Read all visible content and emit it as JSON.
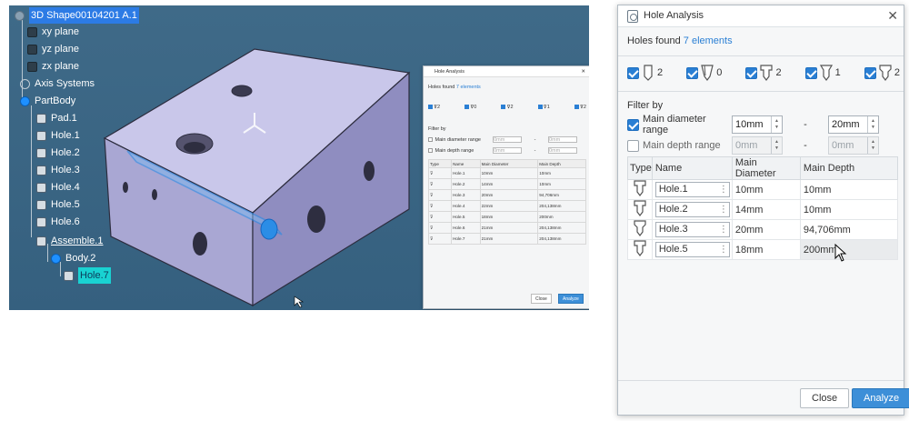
{
  "tree": {
    "root": "3D Shape00104201 A.1",
    "items": [
      {
        "label": "xy plane",
        "icon": "plane-icon"
      },
      {
        "label": "yz plane",
        "icon": "plane-icon"
      },
      {
        "label": "zx plane",
        "icon": "plane-icon"
      },
      {
        "label": "Axis Systems",
        "icon": "axis-system-icon"
      },
      {
        "label": "PartBody",
        "icon": "part-body-icon"
      },
      {
        "label": "Pad.1",
        "icon": "pad-icon"
      },
      {
        "label": "Hole.1",
        "icon": "hole-icon"
      },
      {
        "label": "Hole.2",
        "icon": "hole-icon"
      },
      {
        "label": "Hole.3",
        "icon": "hole-icon"
      },
      {
        "label": "Hole.4",
        "icon": "hole-icon"
      },
      {
        "label": "Hole.5",
        "icon": "hole-icon"
      },
      {
        "label": "Hole.6",
        "icon": "hole-icon"
      },
      {
        "label": "Assemble.1",
        "icon": "assemble-icon"
      },
      {
        "label": "Body.2",
        "icon": "body-icon"
      },
      {
        "label": "Hole.7",
        "icon": "hole-icon"
      }
    ]
  },
  "mini_dialog": {
    "title": "Hole Analysis",
    "found_label": "Holes found",
    "found_count": "7 elements",
    "type_counts": [
      "2",
      "0",
      "2",
      "1",
      "2"
    ],
    "filter_by": "Filter by",
    "diameter_label": "Main diameter range",
    "depth_label": "Main depth range",
    "min_placeholder": "0mm",
    "dash": "-",
    "headers": [
      "Type",
      "Name",
      "Main Diameter",
      "Main Depth"
    ],
    "rows": [
      {
        "name": "Hole.1",
        "diameter": "10mm",
        "depth": "10mm"
      },
      {
        "name": "Hole.2",
        "diameter": "14mm",
        "depth": "10mm"
      },
      {
        "name": "Hole.3",
        "diameter": "20mm",
        "depth": "94,706mm"
      },
      {
        "name": "Hole.4",
        "diameter": "22mm",
        "depth": "204,138mm"
      },
      {
        "name": "Hole.5",
        "diameter": "18mm",
        "depth": "200mm"
      },
      {
        "name": "Hole.6",
        "diameter": "21mm",
        "depth": "204,138mm"
      },
      {
        "name": "Hole.7",
        "diameter": "21mm",
        "depth": "204,138mm"
      }
    ],
    "close_label": "Close",
    "analyze_label": "Analyze"
  },
  "dialog": {
    "title": "Hole Analysis",
    "close_glyph": "✕",
    "found_label": "Holes found",
    "found_count": "7 elements",
    "type_filters": [
      {
        "icon": "simple-hole-icon",
        "count": "2",
        "checked": true
      },
      {
        "icon": "tapered-hole-icon",
        "count": "0",
        "checked": true
      },
      {
        "icon": "counterbored-hole-icon",
        "count": "2",
        "checked": true
      },
      {
        "icon": "countersunk-hole-icon",
        "count": "1",
        "checked": true
      },
      {
        "icon": "counterdrilled-hole-icon",
        "count": "2",
        "checked": true
      }
    ],
    "filter_by": "Filter by",
    "diameter_range": {
      "label": "Main diameter range",
      "checked": true,
      "min": "10mm",
      "max": "20mm"
    },
    "depth_range": {
      "label": "Main depth range",
      "checked": false,
      "min": "0mm",
      "max": "0mm"
    },
    "dash": "-",
    "headers": {
      "type": "Type",
      "name": "Name",
      "diameter": "Main Diameter",
      "depth": "Main Depth"
    },
    "rows": [
      {
        "name": "Hole.1",
        "diameter": "10mm",
        "depth": "10mm"
      },
      {
        "name": "Hole.2",
        "diameter": "14mm",
        "depth": "10mm"
      },
      {
        "name": "Hole.3",
        "diameter": "20mm",
        "depth": "94,706mm"
      },
      {
        "name": "Hole.5",
        "diameter": "18mm",
        "depth": "200mm"
      }
    ],
    "close_label": "Close",
    "analyze_label": "Analyze"
  },
  "colors": {
    "viewport_bg": "#3f6a88",
    "accent": "#2a7fd4",
    "selection_cyan": "#19d2d2",
    "model_face_top": "#c5c3e6",
    "model_face_side": "#9e9cc8"
  }
}
